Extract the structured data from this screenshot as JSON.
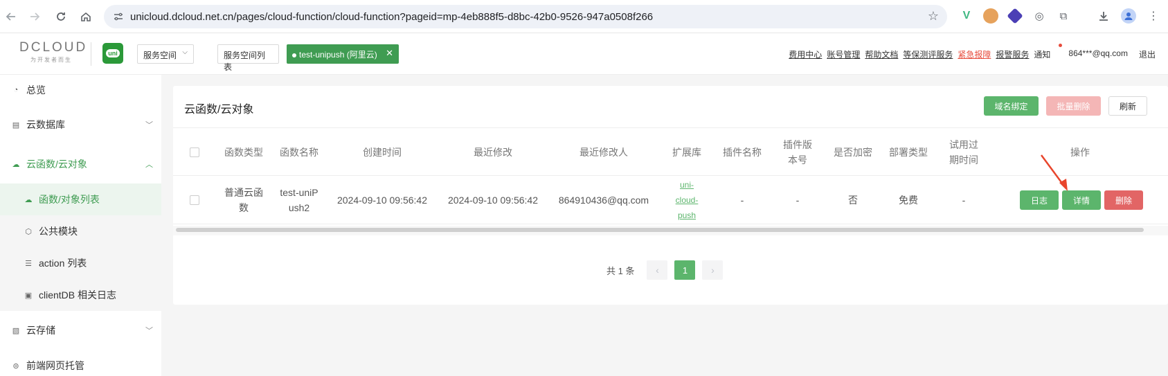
{
  "browser": {
    "url": "unicloud.dcloud.net.cn/pages/cloud-function/cloud-function?pageid=mp-4eb888f5-d8bc-42b0-9526-947a0508f266"
  },
  "header": {
    "logo_name": "DCLOUD",
    "logo_sub": "为开发者而生",
    "uni_logo": "uni",
    "space_select": "服务空间",
    "space_list": "服务空间列表",
    "current_space": "test-unipush (阿里云)",
    "links": {
      "billing": "费用中心",
      "account": "账号管理",
      "help": "帮助文档",
      "security": "等保测评服务",
      "urgent": "紧急报障",
      "alert": "报警服务",
      "notice": "通知",
      "user": "864***@qq.com",
      "logout": "退出"
    }
  },
  "sidebar": {
    "overview": "总览",
    "database": "云数据库",
    "cloud_functions": "云函数/云对象",
    "sub": {
      "function_list": "函数/对象列表",
      "common_modules": "公共模块",
      "action_list": "action 列表",
      "clientdb_logs": "clientDB 相关日志"
    },
    "storage": "云存储",
    "hosting": "前端网页托管"
  },
  "main": {
    "title": "云函数/云对象",
    "buttons": {
      "bind_domain": "域名绑定",
      "batch_delete": "批量删除",
      "refresh": "刷新"
    },
    "table": {
      "headers": {
        "type": "函数类型",
        "name": "函数名称",
        "created": "创建时间",
        "modified": "最近修改",
        "modifier": "最近修改人",
        "ext": "扩展库",
        "plugin": "插件名称",
        "plugin_version": "插件版本号",
        "encrypted": "是否加密",
        "deploy": "部署类型",
        "trial_expire": "试用过期时间",
        "actions": "操作"
      },
      "row": {
        "type": "普通云函数",
        "name": "test-uniPush2",
        "created": "2024-09-10 09:56:42",
        "modified": "2024-09-10 09:56:42",
        "modifier": "864910436@qq.com",
        "ext": "uni-cloud-push",
        "plugin": "-",
        "plugin_version": "-",
        "encrypted": "否",
        "deploy": "免费",
        "trial_expire": "-",
        "btn_log": "日志",
        "btn_detail": "详情",
        "btn_delete": "删除"
      }
    },
    "pagination": {
      "total": "共 1 条",
      "current_page": "1"
    }
  },
  "colors": {
    "brand_green": "#3f9c52",
    "button_green": "#5cb56c",
    "danger": "#e26565",
    "annotation_arrow": "#e8452c"
  }
}
